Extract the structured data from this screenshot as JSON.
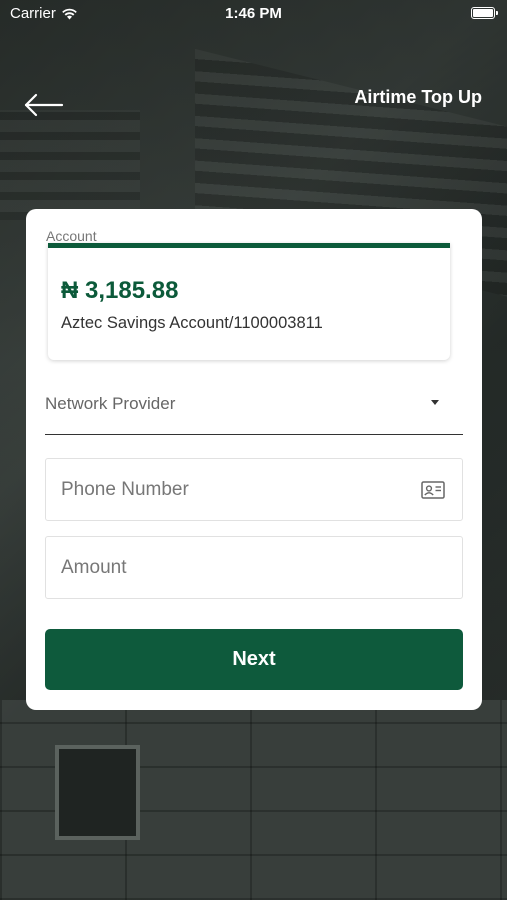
{
  "status_bar": {
    "carrier": "Carrier",
    "time": "1:46 PM"
  },
  "header": {
    "title": "Airtime Top Up"
  },
  "account": {
    "label": "Account",
    "balance": "₦ 3,185.88",
    "name": "Aztec Savings Account/1100003811"
  },
  "form": {
    "network_placeholder": "Network Provider",
    "phone_placeholder": "Phone Number",
    "amount_placeholder": "Amount",
    "next_label": "Next"
  },
  "icons": {
    "back": "back-arrow-icon",
    "wifi": "wifi-icon",
    "battery": "battery-icon",
    "dropdown": "caret-down-icon",
    "contact": "contact-card-icon"
  },
  "colors": {
    "accent": "#0e5a3c",
    "balance": "#0c5a3a"
  }
}
